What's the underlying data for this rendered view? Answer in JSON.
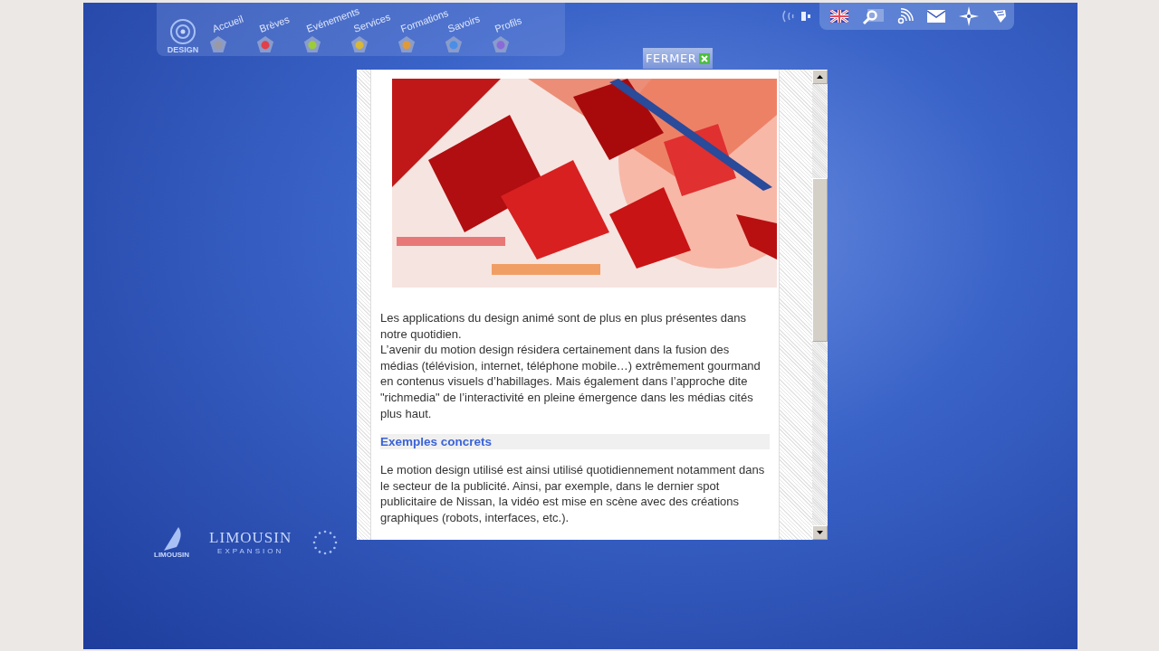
{
  "logo": {
    "text": "DESIGN"
  },
  "nav": [
    {
      "label": "Accueil",
      "color": "#9a9aa6"
    },
    {
      "label": "Brèves",
      "color": "#e0404a"
    },
    {
      "label": "Evénements",
      "color": "#9ccc3a"
    },
    {
      "label": "Services",
      "color": "#d8b838"
    },
    {
      "label": "Formations",
      "color": "#e09a38"
    },
    {
      "label": "Savoirs",
      "color": "#4a8ee8"
    },
    {
      "label": "Profils",
      "color": "#8a6ad8"
    }
  ],
  "close_button": {
    "label": "FERMER"
  },
  "article": {
    "image": {
      "kind": "picture"
    },
    "paragraphs": [
      "Les applications du design animé sont de plus en plus présentes dans notre quotidien.",
      "L’avenir du motion design résidera certainement dans la fusion des médias (télévision, internet, téléphone mobile…) extrêmement gourmand en contenus visuels d’habillages. Mais également dans l’approche dite \"richmedia\" de l’interactivité en pleine émergence dans les médias cités plus haut."
    ],
    "heading": "Exemples concrets",
    "paragraphs_2": [
      "Le motion design utilisé est ainsi utilisé quotidiennement notamment dans le secteur de la publicité. Ainsi, par exemple, dans le dernier spot publicitaire de Nissan, la vidéo est mise en scène avec des créations graphiques (robots, interfaces, etc.)."
    ]
  },
  "footer_logos": {
    "region": "LIMOUSIN",
    "expansion_name": "LIMOUSIN",
    "expansion_sub": "EXPANSION"
  }
}
